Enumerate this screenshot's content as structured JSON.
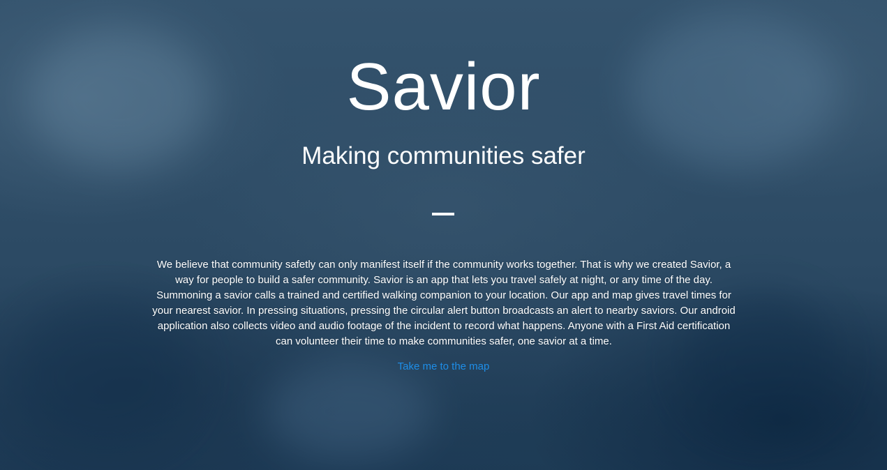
{
  "hero": {
    "title": "Savior",
    "subtitle": "Making communities safer",
    "description": "We believe that community safetly can only manifest itself if the community works together. That is why we created Savior, a way for people to build a safer community. Savior is an app that lets you travel safely at night, or any time of the day. Summoning a savior calls a trained and certified walking companion to your location. Our app and map gives travel times for your nearest savior. In pressing situations, pressing the circular alert button broadcasts an alert to nearby saviors. Our android application also collects video and audio footage of the incident to record what happens. Anyone with a First Aid certification can volunteer their time to make communities safer, one savior at a time.",
    "map_link": "Take me to the map"
  },
  "colors": {
    "background": "#2e4a63",
    "text": "#ffffff",
    "link": "#1e8ee8"
  }
}
